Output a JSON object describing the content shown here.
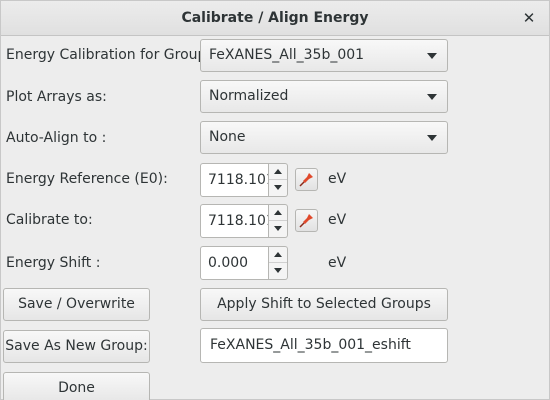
{
  "window": {
    "title": "Calibrate / Align Energy",
    "close_glyph": "✕"
  },
  "form": {
    "group_label": "Energy Calibration for Group:",
    "group_value": "FeXANES_All_35b_001",
    "plot_label": "Plot Arrays as:",
    "plot_value": "Normalized",
    "align_label": "Auto-Align to :",
    "align_value": "None",
    "e0_label": "Energy Reference (E0):",
    "e0_value": "7118.101",
    "calib_label": "Calibrate to:",
    "calib_value": "7118.101",
    "shift_label": "Energy Shift :",
    "shift_value": "0.000",
    "unit": "eV"
  },
  "buttons": {
    "save_overwrite": "Save / Overwrite",
    "apply_shift": "Apply Shift to Selected Groups",
    "save_new": "Save As New Group:",
    "done": "Done"
  },
  "new_group_name": "FeXANES_All_35b_001_eshift",
  "icons": {
    "picker": "pin-icon",
    "accent": "#e0492b"
  }
}
